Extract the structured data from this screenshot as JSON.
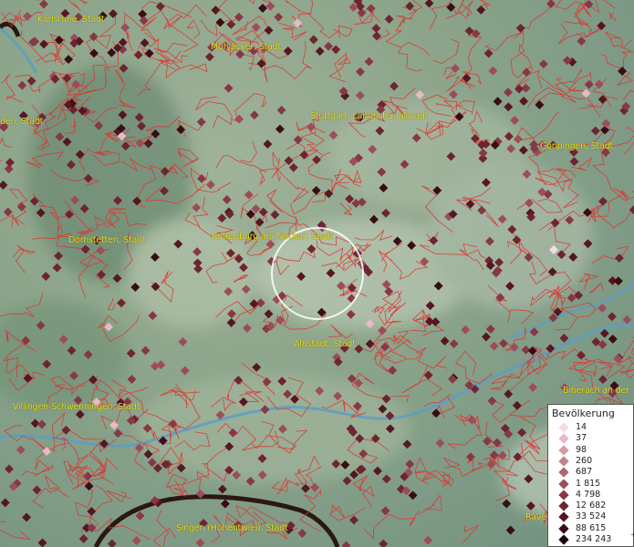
{
  "map": {
    "cities": [
      {
        "name": "Karlsruhe, Stadt"
      },
      {
        "name": "Mühlacker, Stadt"
      },
      {
        "name": "Baden-Baden, Stadt"
      },
      {
        "name": "Stuttgart, Landeshauptstadt"
      },
      {
        "name": "Göppingen, Stadt"
      },
      {
        "name": "Dornstetten, Stadt"
      },
      {
        "name": "Rottenburg am Neckar, Stadt"
      },
      {
        "name": "Albstadt, Stadt"
      },
      {
        "name": "Biberach an der"
      },
      {
        "name": "Villingen-Schwenningen, Stadt"
      },
      {
        "name": "Singen (Hohentwiel), Stadt"
      },
      {
        "name": "Rave"
      }
    ],
    "colors": {
      "border_lines": "#e0322f",
      "river": "#5b9fc4",
      "highlight_circle": "#ffffff"
    }
  },
  "legend": {
    "title": "Bevölkerung",
    "items": [
      {
        "label": "14",
        "color": "#f6dbe4"
      },
      {
        "label": "37",
        "color": "#e7bac6"
      },
      {
        "label": "98",
        "color": "#d49aa8"
      },
      {
        "label": "260",
        "color": "#c27f8d"
      },
      {
        "label": "687",
        "color": "#b06673"
      },
      {
        "label": "1 815",
        "color": "#9c4d59"
      },
      {
        "label": "4 798",
        "color": "#873845"
      },
      {
        "label": "12 682",
        "color": "#6e2431"
      },
      {
        "label": "33 524",
        "color": "#551722"
      },
      {
        "label": "88 615",
        "color": "#3a0c15"
      },
      {
        "label": "234 243",
        "color": "#1e040a"
      }
    ],
    "overflow_marker": "+"
  }
}
